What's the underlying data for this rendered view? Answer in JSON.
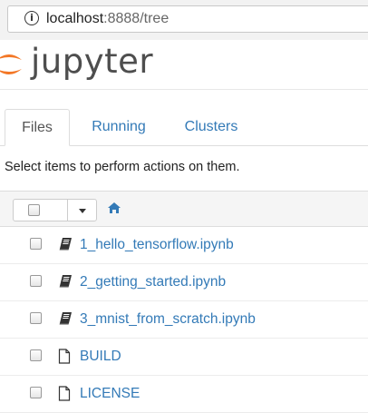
{
  "browser": {
    "url_host": "localhost",
    "url_rest": ":8888/tree"
  },
  "header": {
    "logo_text": "jupyter"
  },
  "tabs": [
    {
      "label": "Files",
      "active": true
    },
    {
      "label": "Running",
      "active": false
    },
    {
      "label": "Clusters",
      "active": false
    }
  ],
  "hint_text": "Select items to perform actions on them.",
  "files": [
    {
      "name": "1_hello_tensorflow.ipynb",
      "kind": "notebook"
    },
    {
      "name": "2_getting_started.ipynb",
      "kind": "notebook"
    },
    {
      "name": "3_mnist_from_scratch.ipynb",
      "kind": "notebook"
    },
    {
      "name": "BUILD",
      "kind": "file"
    },
    {
      "name": "LICENSE",
      "kind": "file"
    }
  ],
  "colors": {
    "link": "#337ab7",
    "logo_orange": "#f37726"
  }
}
